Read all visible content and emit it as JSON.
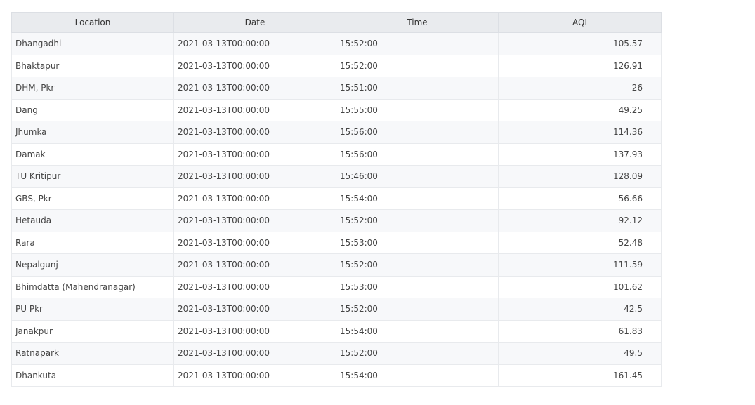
{
  "table": {
    "columns": [
      "Location",
      "Date",
      "Time",
      "AQI"
    ],
    "rows": [
      [
        "Dhangadhi",
        "2021-03-13T00:00:00",
        "15:52:00",
        "105.57"
      ],
      [
        "Bhaktapur",
        "2021-03-13T00:00:00",
        "15:52:00",
        "126.91"
      ],
      [
        "DHM, Pkr",
        "2021-03-13T00:00:00",
        "15:51:00",
        "26"
      ],
      [
        "Dang",
        "2021-03-13T00:00:00",
        "15:55:00",
        "49.25"
      ],
      [
        "Jhumka",
        "2021-03-13T00:00:00",
        "15:56:00",
        "114.36"
      ],
      [
        "Damak",
        "2021-03-13T00:00:00",
        "15:56:00",
        "137.93"
      ],
      [
        "TU Kritipur",
        "2021-03-13T00:00:00",
        "15:46:00",
        "128.09"
      ],
      [
        "GBS, Pkr",
        "2021-03-13T00:00:00",
        "15:54:00",
        "56.66"
      ],
      [
        "Hetauda",
        "2021-03-13T00:00:00",
        "15:52:00",
        "92.12"
      ],
      [
        "Rara",
        "2021-03-13T00:00:00",
        "15:53:00",
        "52.48"
      ],
      [
        "Nepalgunj",
        "2021-03-13T00:00:00",
        "15:52:00",
        "111.59"
      ],
      [
        "Bhimdatta (Mahendranagar)",
        "2021-03-13T00:00:00",
        "15:53:00",
        "101.62"
      ],
      [
        "PU Pkr",
        "2021-03-13T00:00:00",
        "15:52:00",
        "42.5"
      ],
      [
        "Janakpur",
        "2021-03-13T00:00:00",
        "15:54:00",
        "61.83"
      ],
      [
        "Ratnapark",
        "2021-03-13T00:00:00",
        "15:52:00",
        "49.5"
      ],
      [
        "Dhankuta",
        "2021-03-13T00:00:00",
        "15:54:00",
        "161.45"
      ]
    ]
  }
}
